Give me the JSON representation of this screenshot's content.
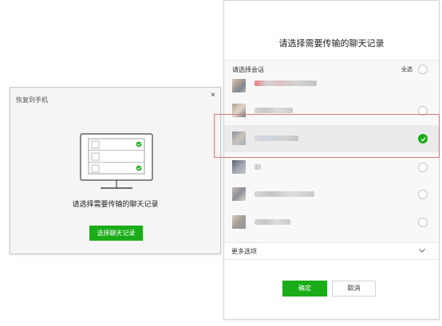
{
  "restore_dialog": {
    "title": "恢复到手机",
    "close_label": "×",
    "prompt": "请选择需要传输的聊天记录",
    "button_label": "选择聊天记录"
  },
  "select_panel": {
    "title": "请选择需要传输的聊天记录",
    "list_header": "请选择会话",
    "select_all": "全选",
    "conversations": [
      {
        "name": "",
        "checked": false
      },
      {
        "name": "",
        "checked": false
      },
      {
        "name": "",
        "checked": true
      },
      {
        "name": "",
        "checked": false
      },
      {
        "name": "",
        "checked": false
      },
      {
        "name": "",
        "checked": false
      }
    ],
    "more_options": "更多选项",
    "confirm_label": "确定",
    "cancel_label": "取消"
  },
  "colors": {
    "brand_green": "#1aad19",
    "highlight_border": "#d67a7a"
  }
}
